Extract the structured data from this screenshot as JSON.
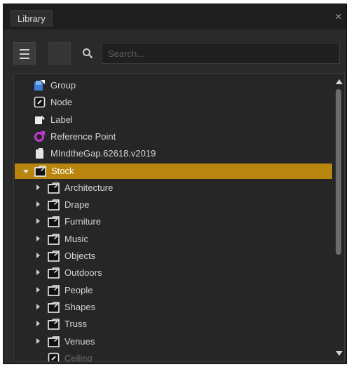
{
  "window": {
    "tab_title": "Library",
    "close_glyph": "×"
  },
  "toolbar": {
    "search_placeholder": "Search..."
  },
  "tree": {
    "items": [
      {
        "label": "Group",
        "icon": "group-icon",
        "depth": 0
      },
      {
        "label": "Node",
        "icon": "node-icon",
        "depth": 0
      },
      {
        "label": "Label",
        "icon": "label-icon",
        "depth": 0
      },
      {
        "label": "Reference Point",
        "icon": "reference-point-icon",
        "depth": 0
      },
      {
        "label": "MIndtheGap.62618.v2019",
        "icon": "file-icon",
        "depth": 0
      },
      {
        "label": "Stock",
        "icon": "folder-icon",
        "depth": 0,
        "expanded": true,
        "selected": true
      },
      {
        "label": "Architecture",
        "icon": "folder-icon",
        "depth": 1,
        "collapsed": true
      },
      {
        "label": "Drape",
        "icon": "folder-icon",
        "depth": 1,
        "collapsed": true
      },
      {
        "label": "Furniture",
        "icon": "folder-icon",
        "depth": 1,
        "collapsed": true
      },
      {
        "label": "Music",
        "icon": "folder-icon",
        "depth": 1,
        "collapsed": true
      },
      {
        "label": "Objects",
        "icon": "folder-icon",
        "depth": 1,
        "collapsed": true
      },
      {
        "label": "Outdoors",
        "icon": "folder-icon",
        "depth": 1,
        "collapsed": true
      },
      {
        "label": "People",
        "icon": "folder-icon",
        "depth": 1,
        "collapsed": true
      },
      {
        "label": "Shapes",
        "icon": "folder-icon",
        "depth": 1,
        "collapsed": true
      },
      {
        "label": "Truss",
        "icon": "folder-icon",
        "depth": 1,
        "collapsed": true
      },
      {
        "label": "Venues",
        "icon": "folder-icon",
        "depth": 1,
        "collapsed": true
      },
      {
        "label": "Ceiling",
        "icon": "node-icon",
        "depth": 1,
        "faded": true
      }
    ]
  },
  "colors": {
    "selection": "#b8860f",
    "group_icon": "#3d7fd6",
    "reference_point_icon": "#c43ad4",
    "panel_bg": "#2a2a2a"
  }
}
